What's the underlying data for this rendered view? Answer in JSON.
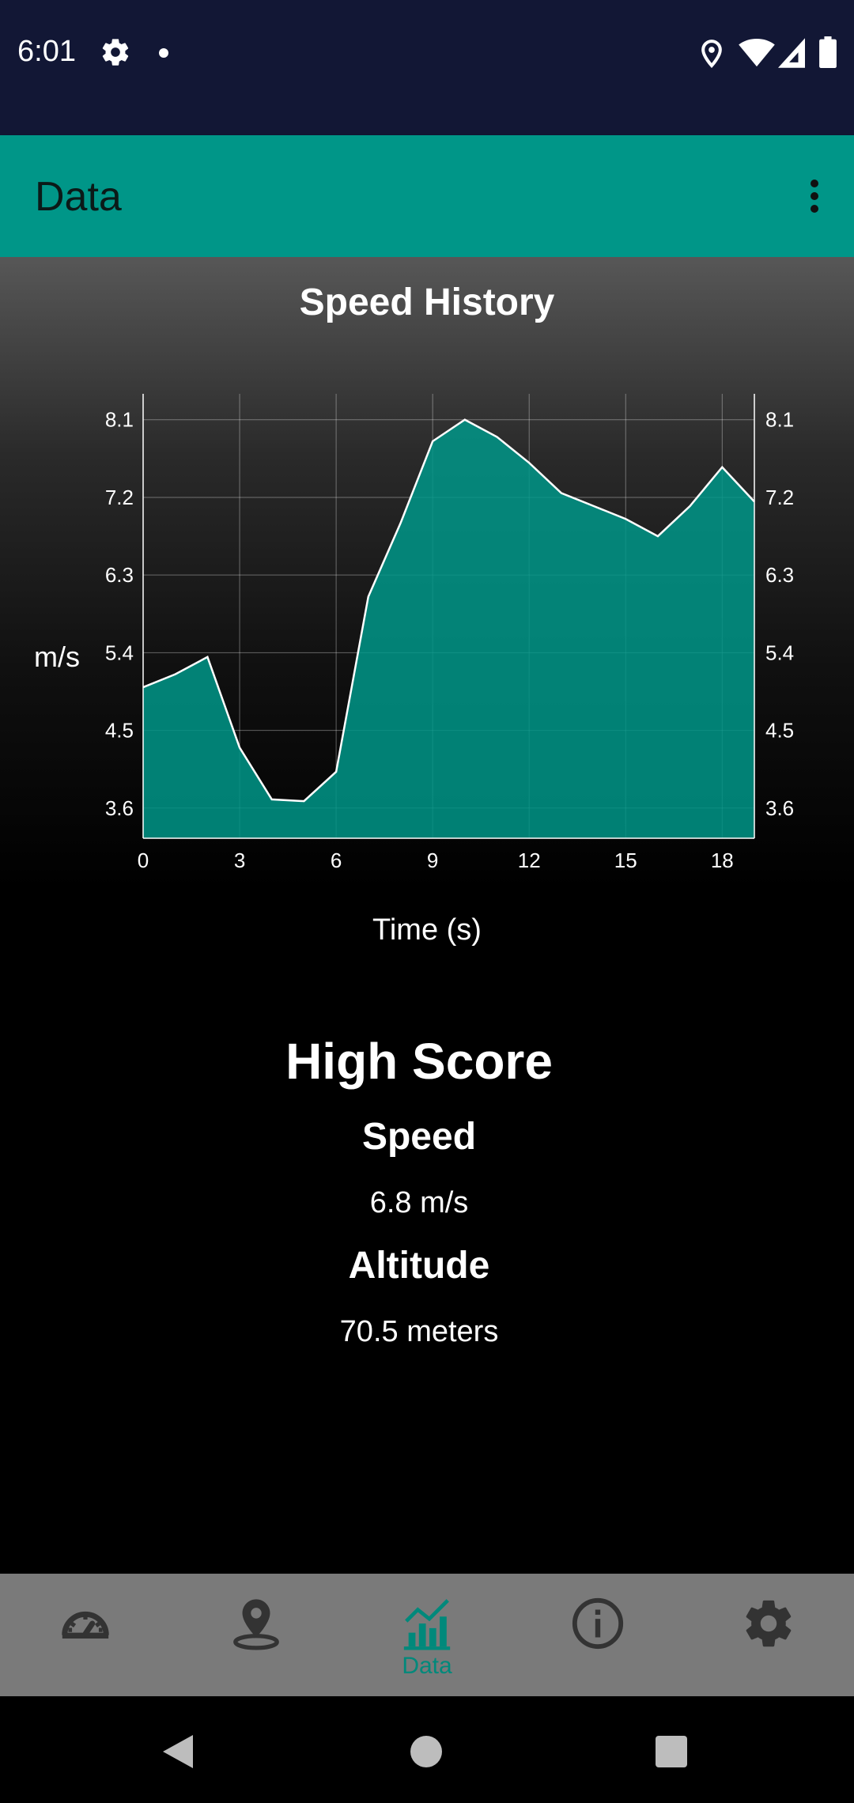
{
  "status": {
    "time": "6:01"
  },
  "appbar": {
    "title": "Data"
  },
  "chart": {
    "title": "Speed History",
    "ylabel": "m/s",
    "xlabel": "Time (s)"
  },
  "chart_data": {
    "type": "area",
    "x": [
      0,
      1,
      2,
      3,
      4,
      5,
      6,
      7,
      8,
      9,
      10,
      11,
      12,
      13,
      14,
      15,
      16,
      17,
      18,
      19
    ],
    "y": [
      5.0,
      5.15,
      5.35,
      4.3,
      3.7,
      3.68,
      4.02,
      6.05,
      6.9,
      7.85,
      8.1,
      7.9,
      7.6,
      7.25,
      7.1,
      6.95,
      6.75,
      7.1,
      7.55,
      7.15
    ],
    "xlim": [
      0,
      19
    ],
    "ylim": [
      3.25,
      8.4
    ],
    "xticks": [
      "0",
      "3",
      "6",
      "9",
      "12",
      "15",
      "18"
    ],
    "yticks": [
      "3.6",
      "4.5",
      "5.4",
      "6.3",
      "7.2",
      "8.1"
    ],
    "title": "Speed History",
    "xlabel": "Time (s)",
    "ylabel": "m/s",
    "grid": true,
    "fill_color": "#009688",
    "line_color": "#ffffff"
  },
  "high_score": {
    "title": "High Score",
    "speed_label": "Speed",
    "speed_value": "6.8 m/s",
    "altitude_label": "Altitude",
    "altitude_value": "70.5 meters"
  },
  "nav": {
    "items": [
      {
        "icon": "speedometer-icon",
        "label": ""
      },
      {
        "icon": "map-pin-icon",
        "label": ""
      },
      {
        "icon": "bar-chart-icon",
        "label": "Data"
      },
      {
        "icon": "info-icon",
        "label": ""
      },
      {
        "icon": "gear-icon",
        "label": ""
      }
    ],
    "active_color": "#00897b",
    "inactive_color": "#333333"
  }
}
